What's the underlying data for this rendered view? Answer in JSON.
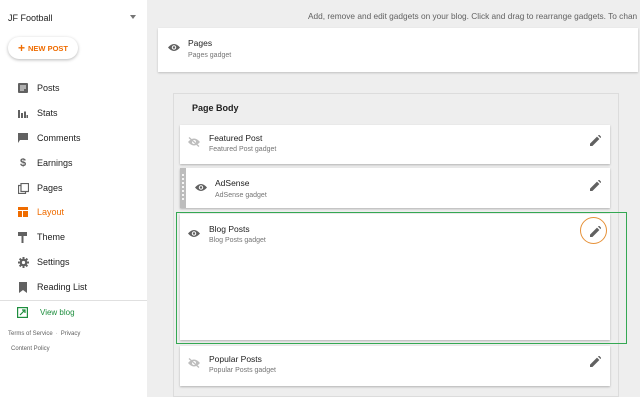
{
  "sidebar": {
    "blog_name": "JF Football",
    "new_post_label": "NEW POST",
    "items": [
      {
        "label": "Posts",
        "icon": "posts-icon"
      },
      {
        "label": "Stats",
        "icon": "stats-icon"
      },
      {
        "label": "Comments",
        "icon": "comments-icon"
      },
      {
        "label": "Earnings",
        "icon": "dollar-icon"
      },
      {
        "label": "Pages",
        "icon": "pages-icon"
      },
      {
        "label": "Layout",
        "icon": "layout-icon",
        "active": true
      },
      {
        "label": "Theme",
        "icon": "paint-roller-icon"
      },
      {
        "label": "Settings",
        "icon": "gear-icon"
      },
      {
        "label": "Reading List",
        "icon": "bookmark-icon"
      }
    ],
    "view_blog_label": "View blog",
    "footer": {
      "terms": "Terms of Service",
      "privacy": "Privacy",
      "content_policy": "Content Policy"
    }
  },
  "main": {
    "header_text": "Add, remove and edit gadgets on your blog. Click and drag to rearrange gadgets. To chan",
    "top_gadget": {
      "title": "Pages",
      "subtitle": "Pages gadget"
    },
    "page_body": {
      "title": "Page Body",
      "gadgets": [
        {
          "title": "Featured Post",
          "subtitle": "Featured Post gadget",
          "visible": false
        },
        {
          "title": "AdSense",
          "subtitle": "AdSense gadget",
          "visible": true
        },
        {
          "title": "Blog Posts",
          "subtitle": "Blog Posts gadget",
          "visible": true
        },
        {
          "title": "Popular Posts",
          "subtitle": "Popular Posts gadget",
          "visible": false
        }
      ]
    }
  },
  "colors": {
    "accent": "#ef6c00",
    "view_blog": "#1e8e3e",
    "highlight_box": "#34a853",
    "edit_circle": "#e69138"
  }
}
